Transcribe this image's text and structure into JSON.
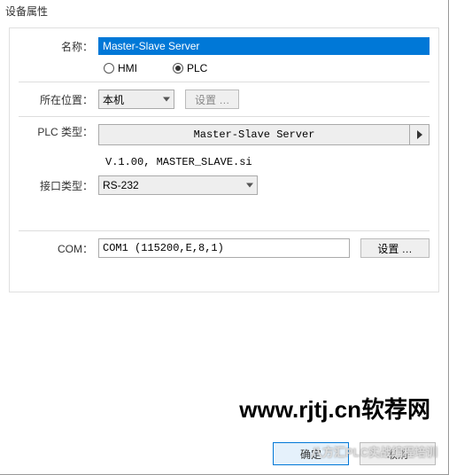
{
  "window": {
    "title": "设备属性"
  },
  "form": {
    "name_label": "名称：",
    "name_value": "Master-Slave Server",
    "radio_hmi": "HMI",
    "radio_plc": "PLC",
    "radio_selected": "PLC",
    "location_label": "所在位置：",
    "location_value": "本机",
    "location_settings_btn": "设置 …",
    "plc_type_label": "PLC 类型：",
    "plc_type_value": "Master-Slave Server",
    "plc_version": "V.1.00, MASTER_SLAVE.si",
    "interface_label": "接口类型：",
    "interface_value": "RS-232",
    "com_label": "COM：",
    "com_value": "COM1 (115200,E,8,1)",
    "com_settings_btn": "设置 …"
  },
  "footer": {
    "ok": "确定",
    "cancel": "取消"
  },
  "watermark": {
    "main": "www.rjtj.cn软荐网",
    "sub": "八方汇PLC实战编程培训"
  }
}
